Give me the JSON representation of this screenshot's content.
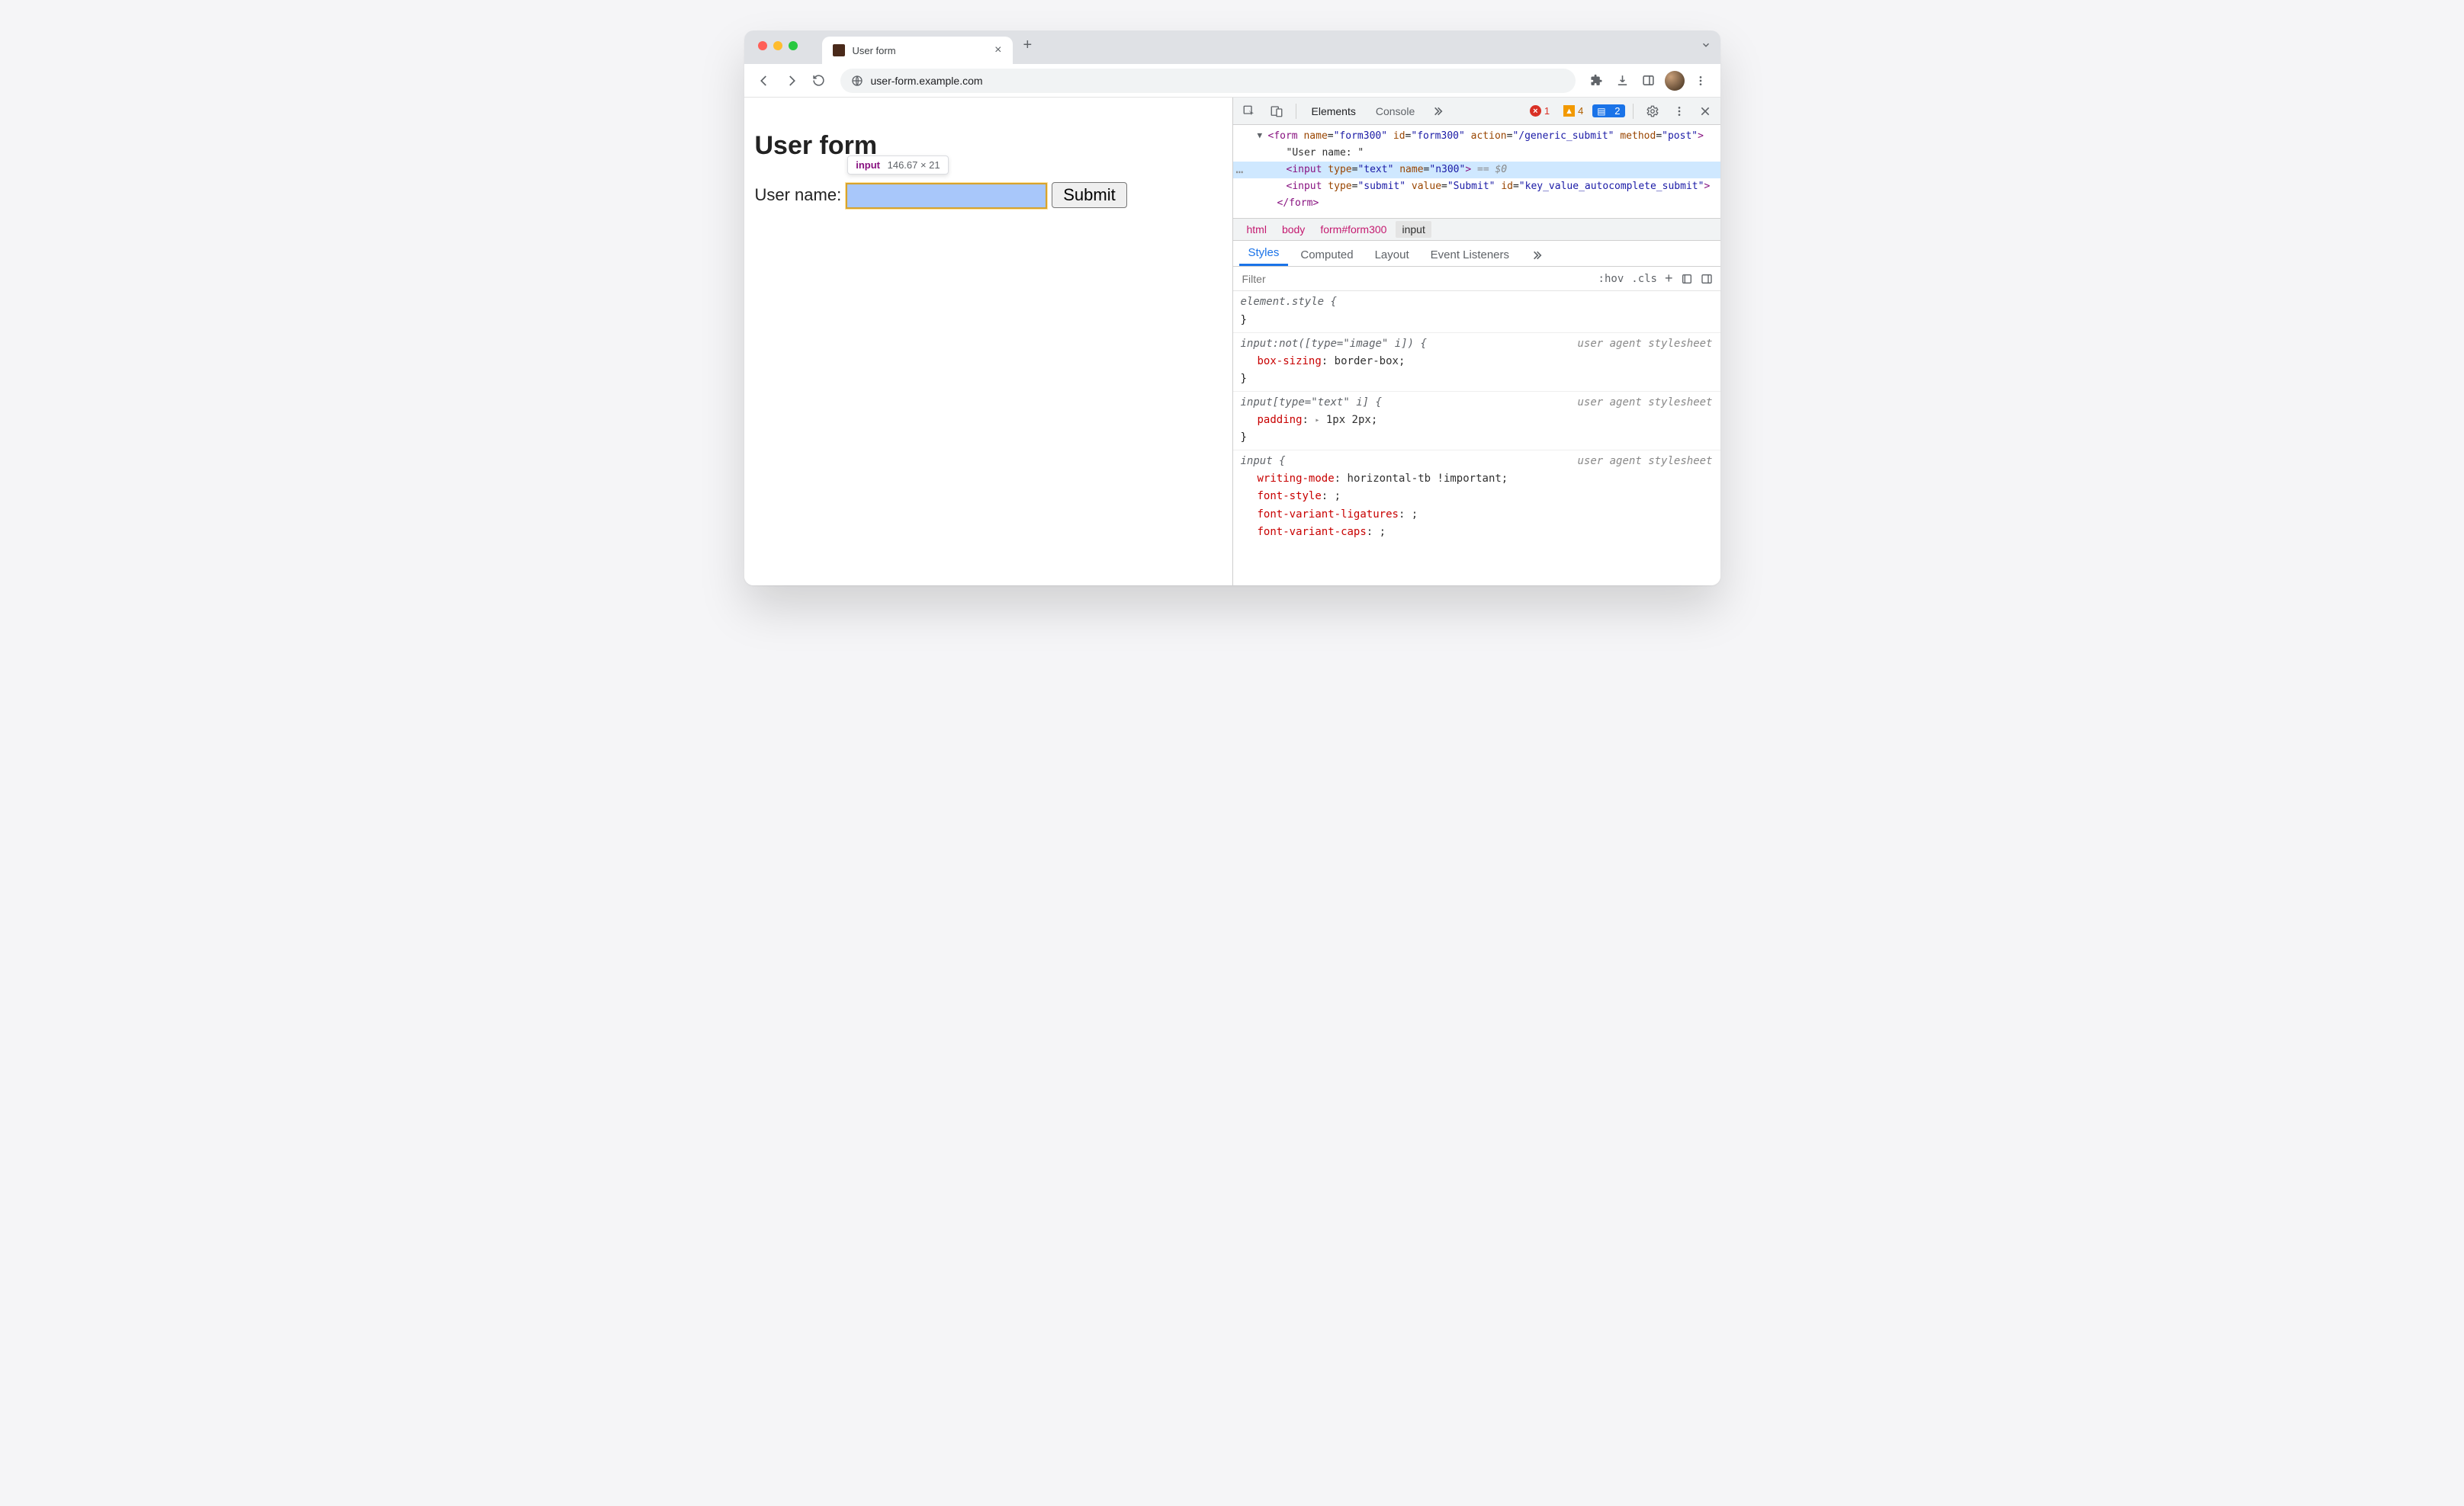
{
  "tab": {
    "title": "User form"
  },
  "url": "user-form.example.com",
  "page": {
    "heading": "User form",
    "label": "User name:",
    "submit": "Submit",
    "tooltip_tag": "input",
    "tooltip_dims": "146.67 × 21"
  },
  "devtools": {
    "tabs": {
      "elements": "Elements",
      "console": "Console"
    },
    "counts": {
      "errors": "1",
      "warnings": "4",
      "issues": "2"
    },
    "dom": {
      "form_open": "<form name=\"form300\" id=\"form300\" action=\"/generic_submit\" method=\"post\">",
      "textnode": "\"User name: \"",
      "input_sel": "<input type=\"text\" name=\"n300\">",
      "sel_after": " == $0",
      "submit_input": "<input type=\"submit\" value=\"Submit\" id=\"key_value_autocomplete_submit\">",
      "form_close": "</form>"
    },
    "crumbs": [
      "html",
      "body",
      "form#form300",
      "input"
    ],
    "subtabs": {
      "styles": "Styles",
      "computed": "Computed",
      "layout": "Layout",
      "events": "Event Listeners"
    },
    "filter_placeholder": "Filter",
    "toggles": {
      "hov": ":hov",
      "cls": ".cls"
    },
    "rules": {
      "elstyle_sel": "element.style {",
      "close": "}",
      "ua_label": "user agent stylesheet",
      "r1_sel": "input:not([type=\"image\" i]) {",
      "r1_p1_n": "box-sizing",
      "r1_p1_v": ": border-box;",
      "r2_sel": "input[type=\"text\" i] {",
      "r2_p1_n": "padding",
      "r2_p1_v": "1px 2px;",
      "r3_sel": "input {",
      "r3_p1_n": "writing-mode",
      "r3_p1_v": ": horizontal-tb !important;",
      "r3_p2_n": "font-style",
      "r3_p2_v": ": ;",
      "r3_p3_n": "font-variant-ligatures",
      "r3_p3_v": ": ;",
      "r3_p4_n": "font-variant-caps",
      "r3_p4_v": ": ;"
    }
  }
}
